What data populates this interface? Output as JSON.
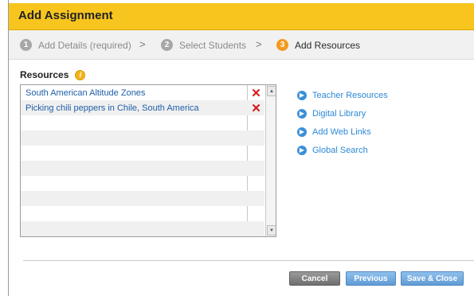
{
  "dialog": {
    "title": "Add Assignment"
  },
  "steps": [
    {
      "number": "1",
      "label": "Add Details (required)"
    },
    {
      "number": "2",
      "label": "Select Students"
    },
    {
      "number": "3",
      "label": "Add Resources"
    }
  ],
  "step_separator": ">",
  "resources": {
    "label": "Resources",
    "info_glyph": "i",
    "items": [
      {
        "title": "South American Altitude Zones"
      },
      {
        "title": "Picking chili peppers in Chile, South America"
      }
    ],
    "remove_glyph": "✕"
  },
  "links": [
    {
      "label": "Teacher Resources",
      "icon": "arrow-circle-icon"
    },
    {
      "label": "Digital Library",
      "icon": "arrow-circle-icon"
    },
    {
      "label": "Add Web Links",
      "icon": "arrow-circle-icon"
    },
    {
      "label": "Global Search",
      "icon": "arrow-circle-icon"
    }
  ],
  "buttons": {
    "cancel": "Cancel",
    "previous": "Previous",
    "save_close": "Save & Close"
  },
  "colors": {
    "title_bar": "#f7c51e",
    "active_step": "#f39a1f",
    "link": "#2d89d6",
    "remove": "#d4171b"
  }
}
